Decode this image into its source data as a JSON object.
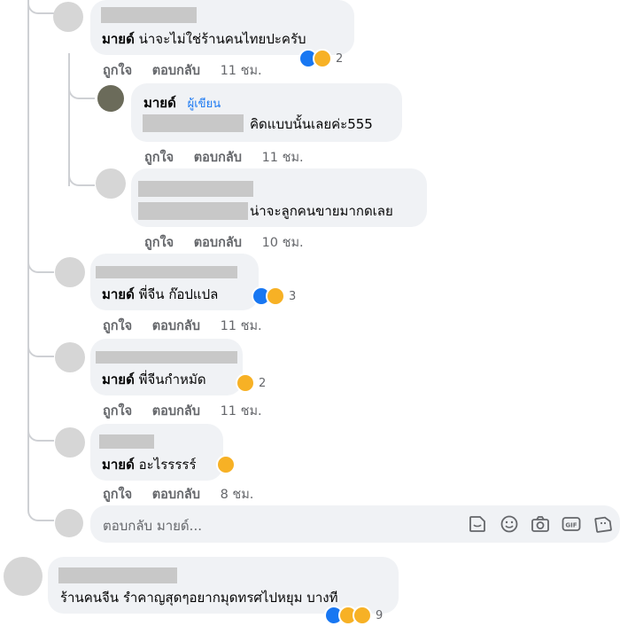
{
  "comments": [
    {
      "mention": "มายด์",
      "text": "น่าจะไม่ใช่ร้านคนไทยปะครับ",
      "actions": [
        "ถูกใจ",
        "ตอบกลับ"
      ],
      "time": "11 ชม.",
      "reaction_count": "2"
    },
    {
      "author": "มายด์",
      "badge": "ผู้เขียน",
      "text": "คิดแบบนั้นเลยค่ะ555",
      "actions": [
        "ถูกใจ",
        "ตอบกลับ"
      ],
      "time": "11 ชม."
    },
    {
      "text": "น่าจะลูกคนขายมากดเลย",
      "actions": [
        "ถูกใจ",
        "ตอบกลับ"
      ],
      "time": "10 ชม."
    },
    {
      "mention": "มายด์",
      "text": "พี่จีน ก๊อปแปล",
      "actions": [
        "ถูกใจ",
        "ตอบกลับ"
      ],
      "time": "11 ชม.",
      "reaction_count": "3"
    },
    {
      "mention": "มายด์",
      "text": "พี่จีนกำหมัด",
      "actions": [
        "ถูกใจ",
        "ตอบกลับ"
      ],
      "time": "11 ชม.",
      "reaction_count": "2"
    },
    {
      "mention": "มายด์",
      "text": "อะไรรรรร์",
      "actions": [
        "ถูกใจ",
        "ตอบกลับ"
      ],
      "time": "8 ชม."
    }
  ],
  "reply_box": {
    "placeholder": "ตอบกลับ มายด์...",
    "icons": [
      "sticker-icon",
      "emoji-icon",
      "camera-icon",
      "gif-icon",
      "avatar-sticker-icon"
    ]
  },
  "bottom_comment": {
    "text": "ร้านคนจีน รำคาญสุดๆอยากมุดทรศไปหยุม บางที",
    "reaction_count": "9"
  },
  "colors": {
    "like": "#1877f2",
    "haha": "#f7b125",
    "link": "#1877f2",
    "muted": "#65676b"
  }
}
